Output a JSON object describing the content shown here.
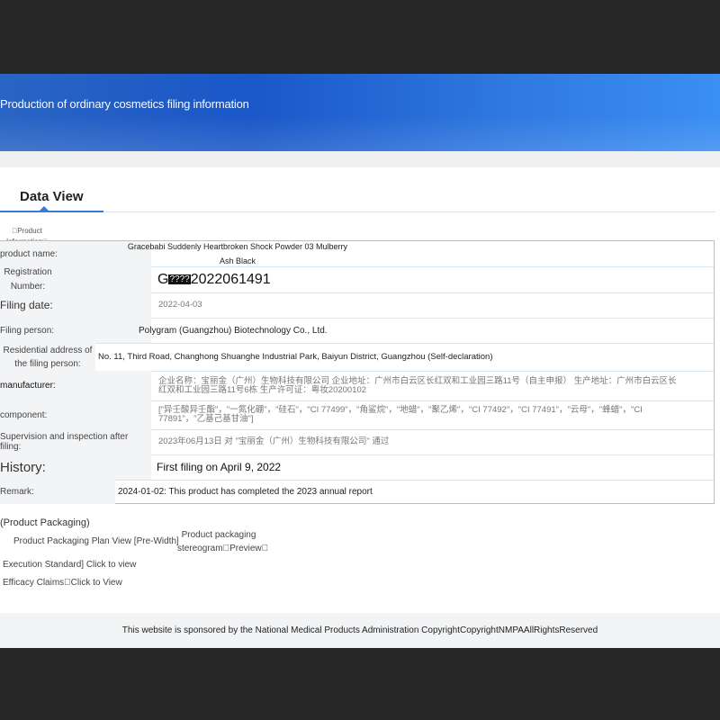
{
  "banner": {
    "title": "Production of ordinary cosmetics filing information"
  },
  "tabs": {
    "data_view": "Data View"
  },
  "section": {
    "product_information": "\u0000Product Information\u0000"
  },
  "rows": {
    "product_name": {
      "label": "product name:",
      "value": "Gracebabi Suddenly Heartbroken Shock Powder 03 Mulberry Ash Black"
    },
    "registration_number": {
      "label": "Registration Number:",
      "prefix": "G",
      "masked": "????",
      "value": "2022061491"
    },
    "filing_date": {
      "label": "Filing date:",
      "value": "2022-04-03"
    },
    "filing_person": {
      "label": "Filing person:",
      "value": "Polygram (Guangzhou) Biotechnology Co., Ltd."
    },
    "residential_address": {
      "label": "Residential address of the filing person:",
      "value": "No. 11, Third Road, Changhong Shuanghe Industrial Park, Baiyun District, Guangzhou (Self-declaration)"
    },
    "manufacturer": {
      "label": "manufacturer:",
      "value": "企业名称：宝丽金（广州）生物科技有限公司 企业地址：广州市白云区长红双和工业园三路11号（自主申报） 生产地址：广州市白云区长红双和工业园三路11号6栋 生产许可证：粤妆20200102"
    },
    "component": {
      "label": "component:",
      "value": "[\"异壬酸异壬酯\"，\"一氮化硼\"，\"硅石\"，\"CI 77499\"，\"角鲨烷\"，\"地蜡\"，\"聚乙烯\"，\"CI 77492\"，\"CI 77491\"，\"云母\"，\"蜂蜡\"，\"CI 77891\"，\"乙基己基甘油\"]"
    },
    "supervision": {
      "label": "Supervision and inspection after filing:",
      "value": "2023年06月13日 对 \"宝丽金（广州）生物科技有限公司\" 通过"
    },
    "history": {
      "label": "History:",
      "value": "First filing on April 9, 2022"
    },
    "remark": {
      "label": "Remark:",
      "value": "2024-01-02: This product has completed the 2023 annual report"
    }
  },
  "packaging": {
    "heading": "(Product Packaging)",
    "plan_view": "Product Packaging Plan View [Pre-Width]",
    "stereogram_line1": "Product packaging",
    "stereogram_line2": "stereogram\u0000Preview\u0000",
    "execution_standard": "Execution Standard] Click to view",
    "efficacy_claims": "Efficacy Claims\u0000Click to View"
  },
  "footer": {
    "text": "This website is sponsored by the National Medical Products Administration CopyrightCopyrightNMPAAllRightsReserved"
  },
  "colors": {
    "banner": "#1a57c8",
    "accent": "#3b7bd8",
    "border": "#a8c3e4"
  }
}
